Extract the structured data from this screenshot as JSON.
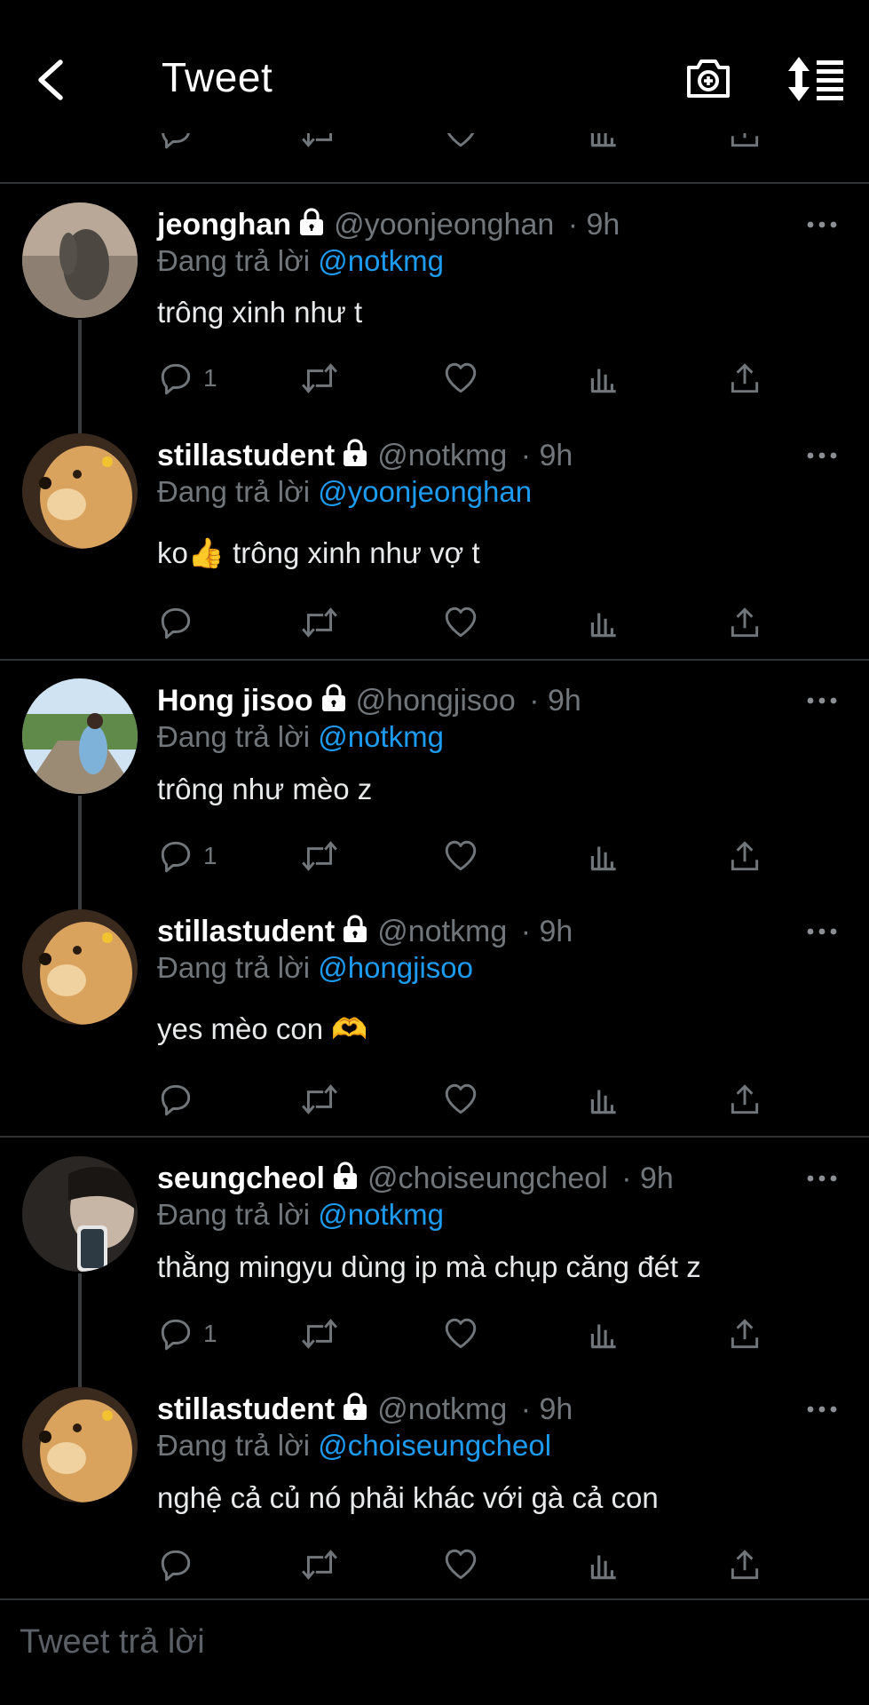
{
  "header": {
    "title": "Tweet"
  },
  "colors": {
    "background": "#000000",
    "divider": "#2f3336",
    "muted": "#71767b",
    "link": "#1d9bf0"
  },
  "icons": {
    "back": "chevron-left-icon",
    "camera": "camera-plus-icon",
    "sort": "sort-icon",
    "reply": "reply-icon",
    "retweet": "retweet-icon",
    "like": "heart-icon",
    "views": "analytics-icon",
    "share": "share-icon",
    "lock": "lock-icon",
    "more": "more-icon"
  },
  "tweets": [
    {
      "name": "jeonghan",
      "handle": "@yoonjeonghan",
      "time": "· 9h",
      "reply_prefix": "Đang trả lời",
      "reply_to": "@notkmg",
      "text": "trông xinh như t",
      "reply_count": "1"
    },
    {
      "name": "stillastudent",
      "handle": "@notkmg",
      "time": "· 9h",
      "reply_prefix": "Đang trả lời",
      "reply_to": "@yoonjeonghan",
      "text": "ko👍  trông xinh như vợ t",
      "reply_count": ""
    },
    {
      "name": "Hong jisoo",
      "handle": "@hongjisoo",
      "time": "· 9h",
      "reply_prefix": "Đang trả lời",
      "reply_to": "@notkmg",
      "text": "trông như mèo z",
      "reply_count": "1"
    },
    {
      "name": "stillastudent",
      "handle": "@notkmg",
      "time": "· 9h",
      "reply_prefix": "Đang trả lời",
      "reply_to": "@hongjisoo",
      "text": "yes mèo con 🫶",
      "reply_count": ""
    },
    {
      "name": "seungcheol",
      "handle": "@choiseungcheol",
      "time": "· 9h",
      "reply_prefix": "Đang trả lời",
      "reply_to": "@notkmg",
      "text": "thằng mingyu dùng ip mà chụp căng đét z",
      "reply_count": "1"
    },
    {
      "name": "stillastudent",
      "handle": "@notkmg",
      "time": "· 9h",
      "reply_prefix": "Đang trả lời",
      "reply_to": "@choiseungcheol",
      "text": "nghệ cả củ nó phải khác với gà cả con",
      "reply_count": ""
    }
  ],
  "composer": {
    "placeholder": "Tweet trả lời"
  }
}
